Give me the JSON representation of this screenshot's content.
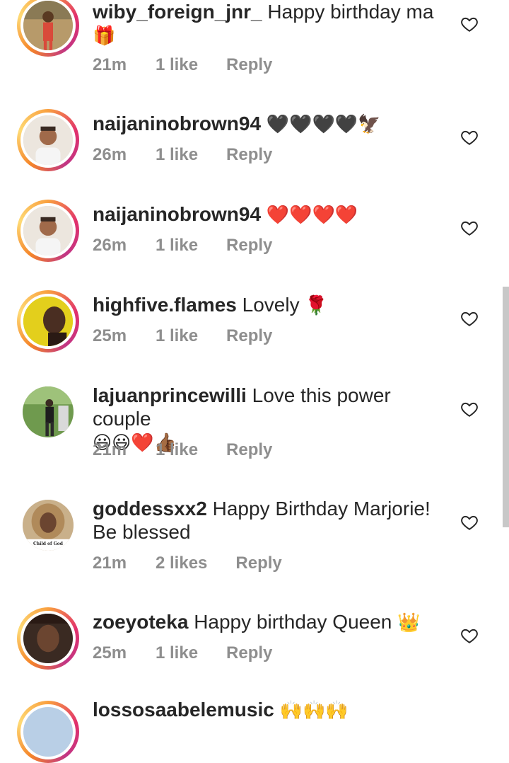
{
  "comments": [
    {
      "username": "wiby_foreign_jnr_",
      "text": "Happy birthday ma",
      "emoji": "🎁",
      "time": "21m",
      "likes": "1 like",
      "reply": "Reply"
    },
    {
      "username": "naijaninobrown94",
      "text": "",
      "emoji": "🖤🖤🖤🖤🦅",
      "time": "26m",
      "likes": "1 like",
      "reply": "Reply"
    },
    {
      "username": "naijaninobrown94",
      "text": "",
      "emoji": "❤️❤️❤️❤️",
      "time": "26m",
      "likes": "1 like",
      "reply": "Reply"
    },
    {
      "username": "highfive.flames",
      "text": "Lovely",
      "emoji": "🌹",
      "time": "25m",
      "likes": "1 like",
      "reply": "Reply"
    },
    {
      "username": "lajuanprincewilli",
      "text": "Love this power couple",
      "emoji": "😃😃❤️👍🏾",
      "time": "21m",
      "likes": "1 like",
      "reply": "Reply"
    },
    {
      "username": "goddessxx2",
      "text": "Happy Birthday Marjorie! Be blessed",
      "emoji": "",
      "time": "21m",
      "likes": "2 likes",
      "reply": "Reply"
    },
    {
      "username": "zoeyoteka",
      "text": "Happy birthday Queen",
      "emoji": "👑",
      "time": "25m",
      "likes": "1 like",
      "reply": "Reply"
    },
    {
      "username": "lossosaabelemusic",
      "text": "",
      "emoji": "🙌🙌🙌",
      "time": "",
      "likes": "",
      "reply": ""
    }
  ],
  "avatar_labels": {
    "goddess_badge": "Child of God"
  },
  "colors": {
    "username": "#262626",
    "meta": "#8e8e8e",
    "story_ring": "#e1306c",
    "heart_stroke": "#262626"
  }
}
